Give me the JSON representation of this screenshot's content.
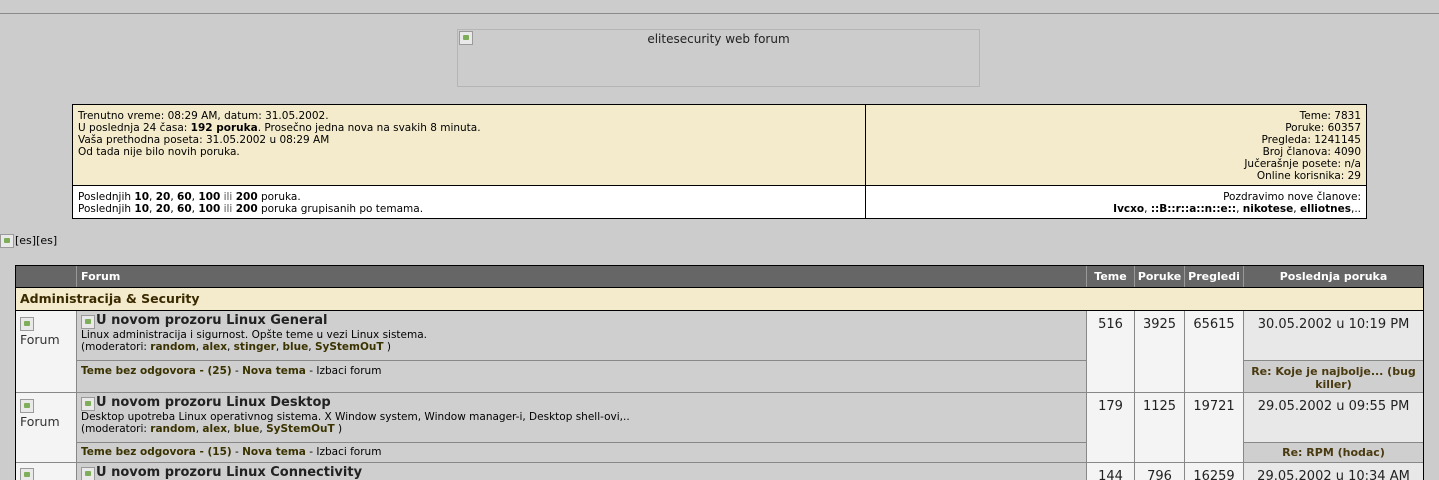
{
  "banner": {
    "alt": "elitesecurity web forum"
  },
  "info": {
    "left_lines": [
      "Trenutno vreme: 08:29 AM, datum: 31.05.2002.",
      "Vaša prethodna poseta: 31.05.2002 u 08:29 AM",
      "Od tada nije bilo novih poruka."
    ],
    "last24_prefix": "U poslednja 24 časa: ",
    "last24_bold": "192 poruka",
    "last24_suffix": ". Prosečno jedna nova na svakih 8 minuta.",
    "stats": [
      "Teme: 7831",
      "Poruke: 60357",
      "Pregleda: 1241145",
      "Broj članova: 4090",
      "Jučerašnje posete: n/a",
      "Online korisnika: 29"
    ],
    "last_prefix": "Poslednjih ",
    "counts": [
      "10",
      "20",
      "60",
      "100"
    ],
    "ili": "ili",
    "last_count": "200",
    "line1_suffix": " poruka.",
    "line2_suffix": " poruka grupisanih po temama.",
    "welcome_label": "Pozdravimo nove članove:",
    "new_members": [
      "Ivcxo",
      "::B::r::a::n::e::",
      "nikotese",
      "elliotnes"
    ],
    "new_members_tail": ",.."
  },
  "lang_alt": "[es][es]",
  "table": {
    "headers": {
      "forum": "Forum",
      "teme": "Teme",
      "poruke": "Poruke",
      "pregledi": "Pregledi",
      "last": "Poslednja poruka"
    },
    "category": "Administracija & Security",
    "icon_alt": "Forum",
    "forums": [
      {
        "title": "U novom prozoru Linux General",
        "desc": "Linux administracija i sigurnost. Opšte teme u vezi Linux sistema.",
        "mods_label": "(moderatori: ",
        "mods": [
          "random",
          "alex",
          "stinger",
          "blue",
          "SyStemOuT"
        ],
        "mods_end": " )",
        "teme": "516",
        "poruke": "3925",
        "pregledi": "65615",
        "last_date": "30.05.2002 u 10:19 PM",
        "unanswered": "Teme bez odgovora - (25)",
        "new_topic": "Nova tema",
        "exclude": "Izbaci forum",
        "last_topic": "Re: Koje je najbolje... (bug killer)"
      },
      {
        "title": "U novom prozoru Linux Desktop",
        "desc": "Desktop upotreba Linux operativnog sistema. X Window system, Window manager-i, Desktop shell-ovi,..",
        "mods_label": "(moderatori: ",
        "mods": [
          "random",
          "alex",
          "blue",
          "SyStemOuT"
        ],
        "mods_end": " )",
        "teme": "179",
        "poruke": "1125",
        "pregledi": "19721",
        "last_date": "29.05.2002 u 09:55 PM",
        "unanswered": "Teme bez odgovora - (15)",
        "new_topic": "Nova tema",
        "exclude": "Izbaci forum",
        "last_topic": "Re: RPM (hodac)"
      },
      {
        "title": "U novom prozoru Linux Connectivity",
        "teme": "144",
        "poruke": "796",
        "pregledi": "16259",
        "last_date": "29.05.2002 u 10:34 AM"
      }
    ],
    "sep": " - ",
    "comma": ", "
  }
}
